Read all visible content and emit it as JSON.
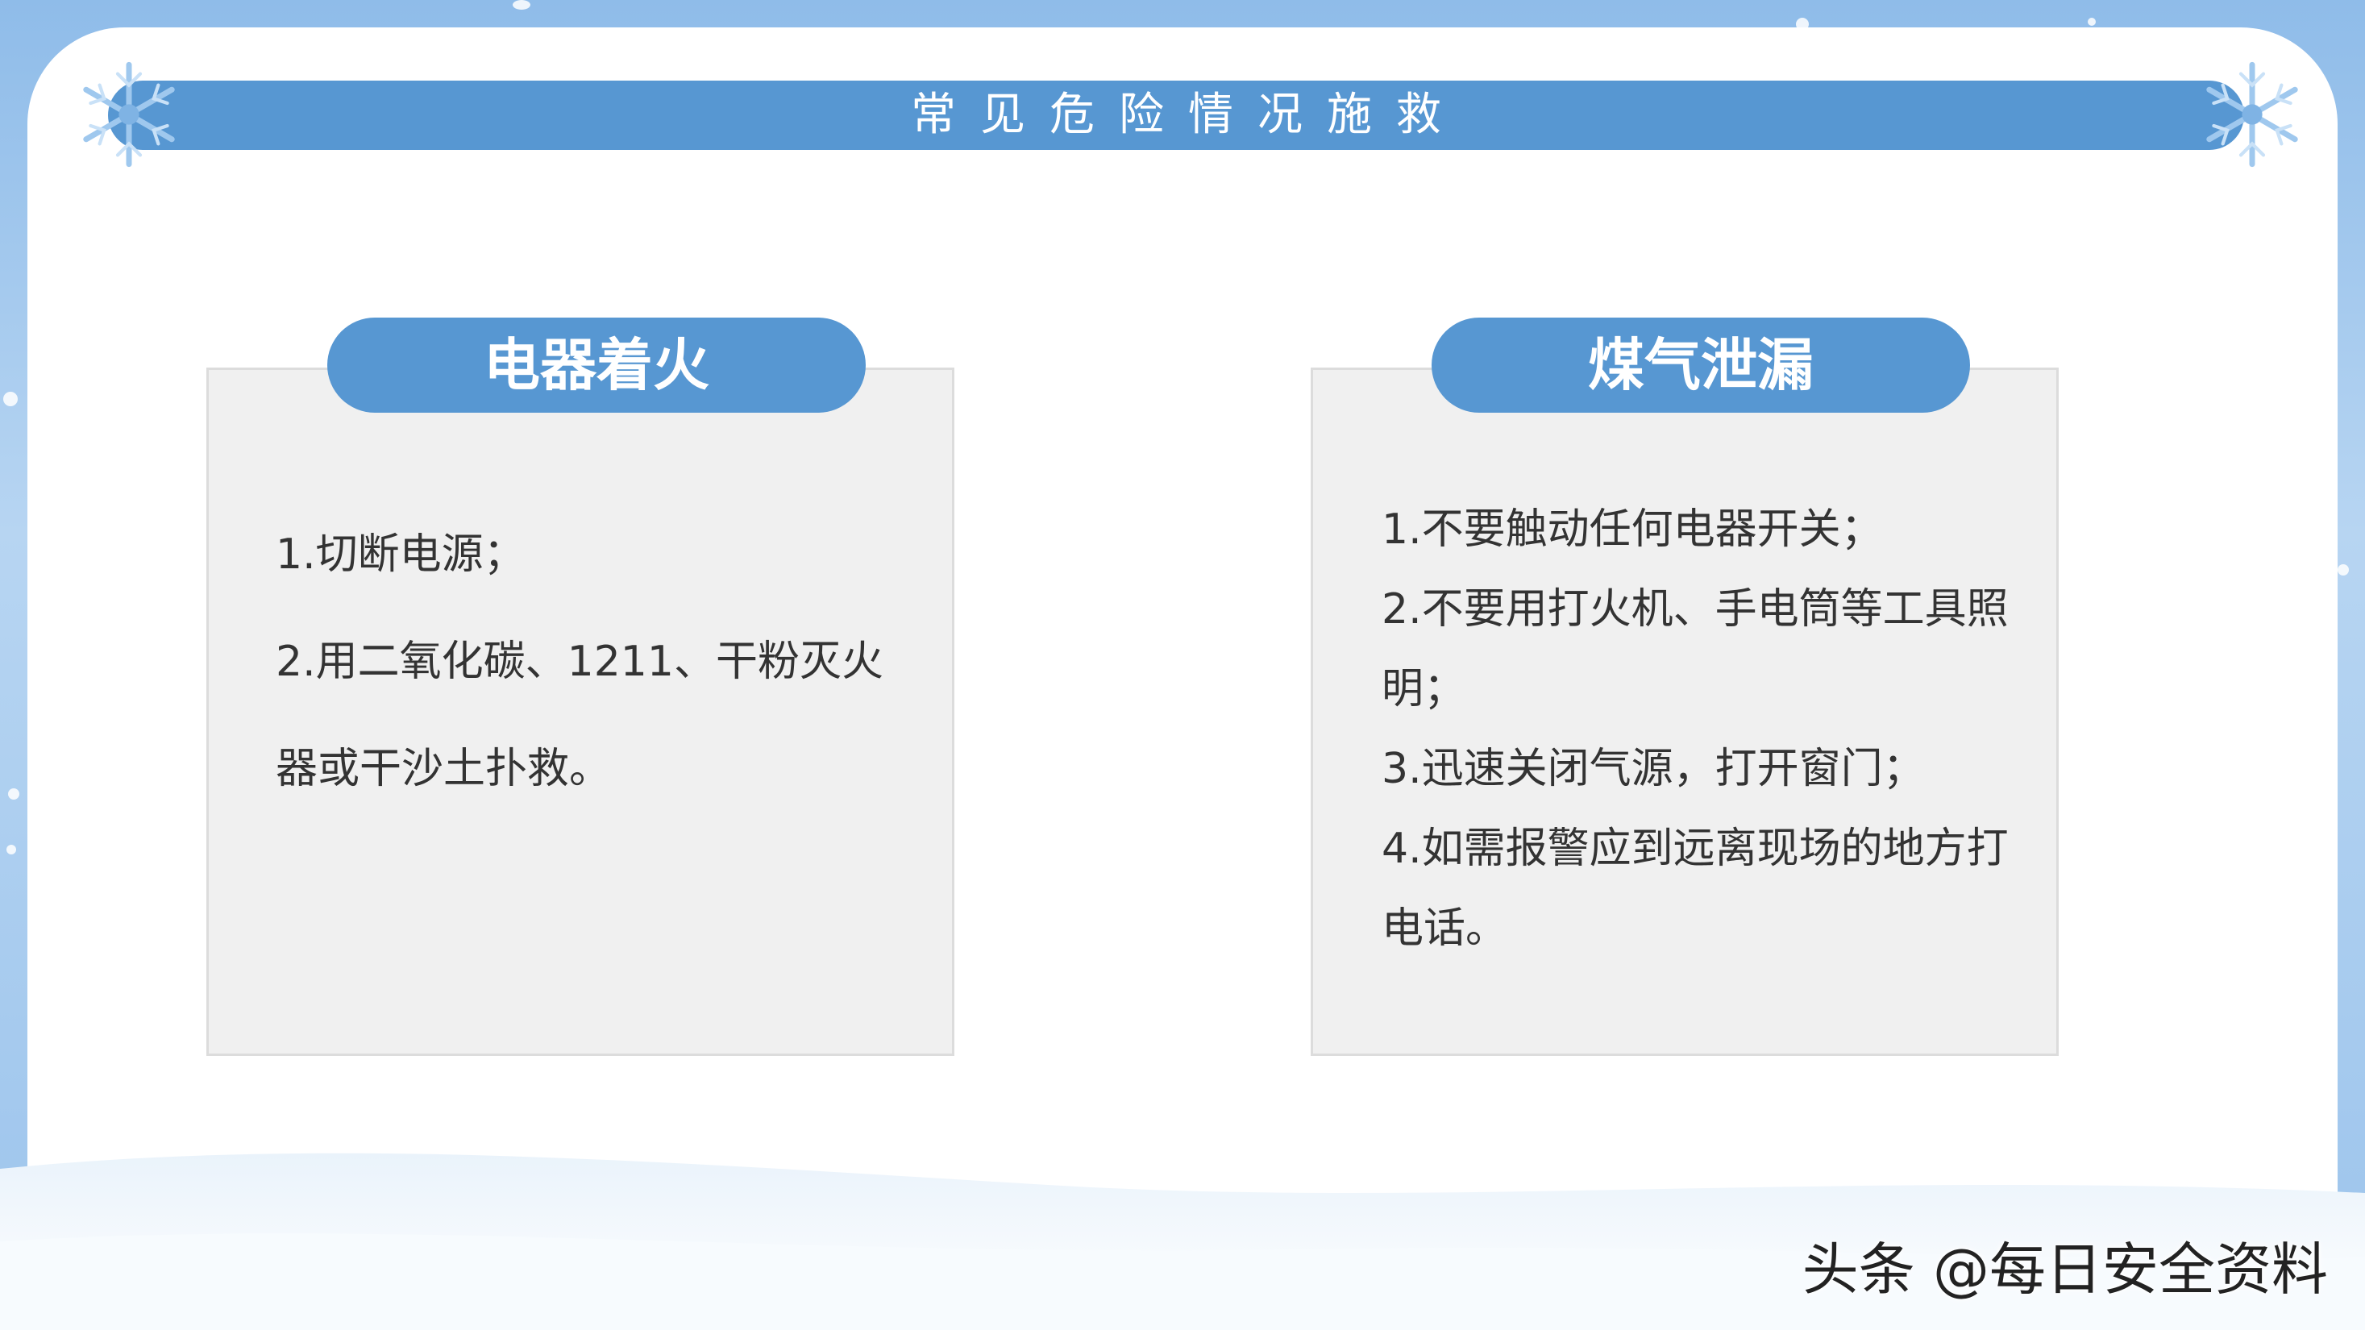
{
  "header": {
    "title": "常见危险情况施救"
  },
  "cards": [
    {
      "title": "电器着火",
      "lines": [
        "1.切断电源；",
        "2.用二氧化碳、1211、干粉灭火器或干沙土扑救。"
      ]
    },
    {
      "title": "煤气泄漏",
      "lines": [
        "1.不要触动任何电器开关；",
        "2.不要用打火机、手电筒等工具照明；",
        "3.迅速关闭气源，打开窗门；",
        "4.如需报警应到远离现场的地方打电话。"
      ]
    }
  ],
  "watermark": {
    "text": "头条 @每日安全资料"
  },
  "colors": {
    "accent": "#5797d2",
    "card_bg": "#f0f0f0",
    "text": "#333333"
  },
  "icons": {
    "corner": "snowflake-icon"
  }
}
